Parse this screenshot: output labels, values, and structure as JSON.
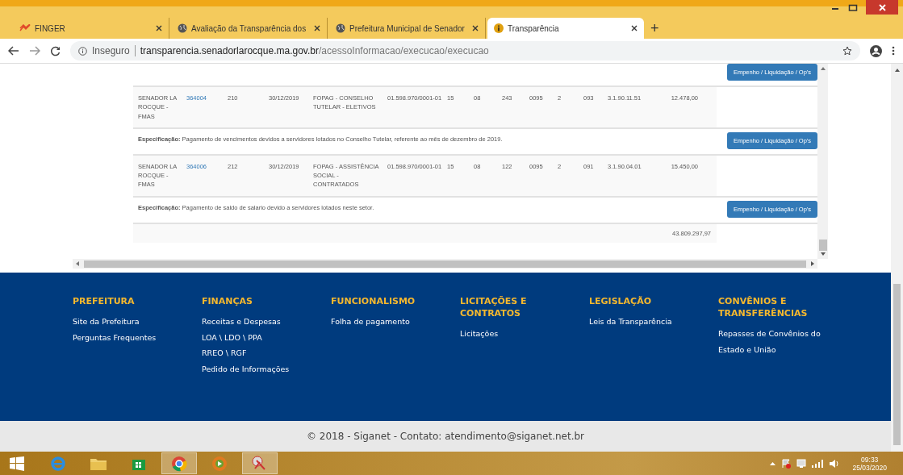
{
  "browser": {
    "tabs": [
      {
        "title": "FINGER",
        "selected": false
      },
      {
        "title": "Avaliação da Transparência dos",
        "selected": false
      },
      {
        "title": "Prefeitura Municipal de Senador",
        "selected": false
      },
      {
        "title": "Transparência",
        "selected": true
      }
    ],
    "new_tab": "+",
    "security": "Inseguro",
    "url_host": "transparencia.senadorlarocque.ma.gov.br",
    "url_path": "/acessoInformacao/execucao/execucao"
  },
  "table": {
    "rows": [
      {
        "kind": "spec",
        "text": "",
        "button": "Empenho / Liquidação / Op's"
      },
      {
        "kind": "data",
        "cells": [
          "SENADOR LA ROCQUE - FMAS",
          "364004",
          "210",
          "30/12/2019",
          "FOPAG - CONSELHO TUTELAR - ELETIVOS",
          "01.598.970/0001-01",
          "15",
          "08",
          "243",
          "0095",
          "2",
          "093",
          "3.1.90.11.51",
          "12.478,00"
        ]
      },
      {
        "kind": "spec",
        "text": "**Especificação:** Pagamento de vencimentos devidos a servidores lotados no Conselho Tutelar, referente ao mês de dezembro de 2019.",
        "button": "Empenho / Liquidação / Op's"
      },
      {
        "kind": "data",
        "cells": [
          "SENADOR LA ROCQUE - FMAS",
          "364006",
          "212",
          "30/12/2019",
          "FOPAG - ASSISTÊNCIA SOCIAL - CONTRATADOS",
          "01.598.970/0001-01",
          "15",
          "08",
          "122",
          "0095",
          "2",
          "091",
          "3.1.90.04.01",
          "15.450,00"
        ]
      },
      {
        "kind": "spec",
        "text": "**Especificação:** Pagamento de saldo de salario devido a servidores lotados neste setor.",
        "button": "Empenho / Liquidação / Op's"
      },
      {
        "kind": "total",
        "value": "43.809.297,97"
      }
    ]
  },
  "footer": {
    "columns": [
      {
        "heading": "PREFEITURA",
        "links": [
          "Site da Prefeitura",
          "Perguntas Frequentes"
        ]
      },
      {
        "heading": "FINANÇAS",
        "links": [
          "Receitas e Despesas",
          "LOA \\ LDO \\ PPA",
          "RREO \\ RGF",
          "Pedido de Informações"
        ]
      },
      {
        "heading": "FUNCIONALISMO",
        "links": [
          "Folha de pagamento"
        ]
      },
      {
        "heading": "LICITAÇÕES E CONTRATOS",
        "links": [
          "Licitações"
        ]
      },
      {
        "heading": "LEGISLAÇÃO",
        "links": [
          "Leis da Transparência"
        ]
      },
      {
        "heading": "CONVÊNIOS E TRANSFERÊNCIAS",
        "links": [
          "Repasses de Convênios do Estado e União"
        ]
      }
    ],
    "copyright": "© 2018 - Siganet - Contato: atendimento@siganet.net.br"
  },
  "taskbar": {
    "apps": [
      {
        "selected": false
      },
      {
        "selected": false
      },
      {
        "selected": false
      },
      {
        "selected": true
      },
      {
        "selected": false
      },
      {
        "selected": true
      }
    ],
    "time": "09:33",
    "date": "25/03/2020"
  }
}
